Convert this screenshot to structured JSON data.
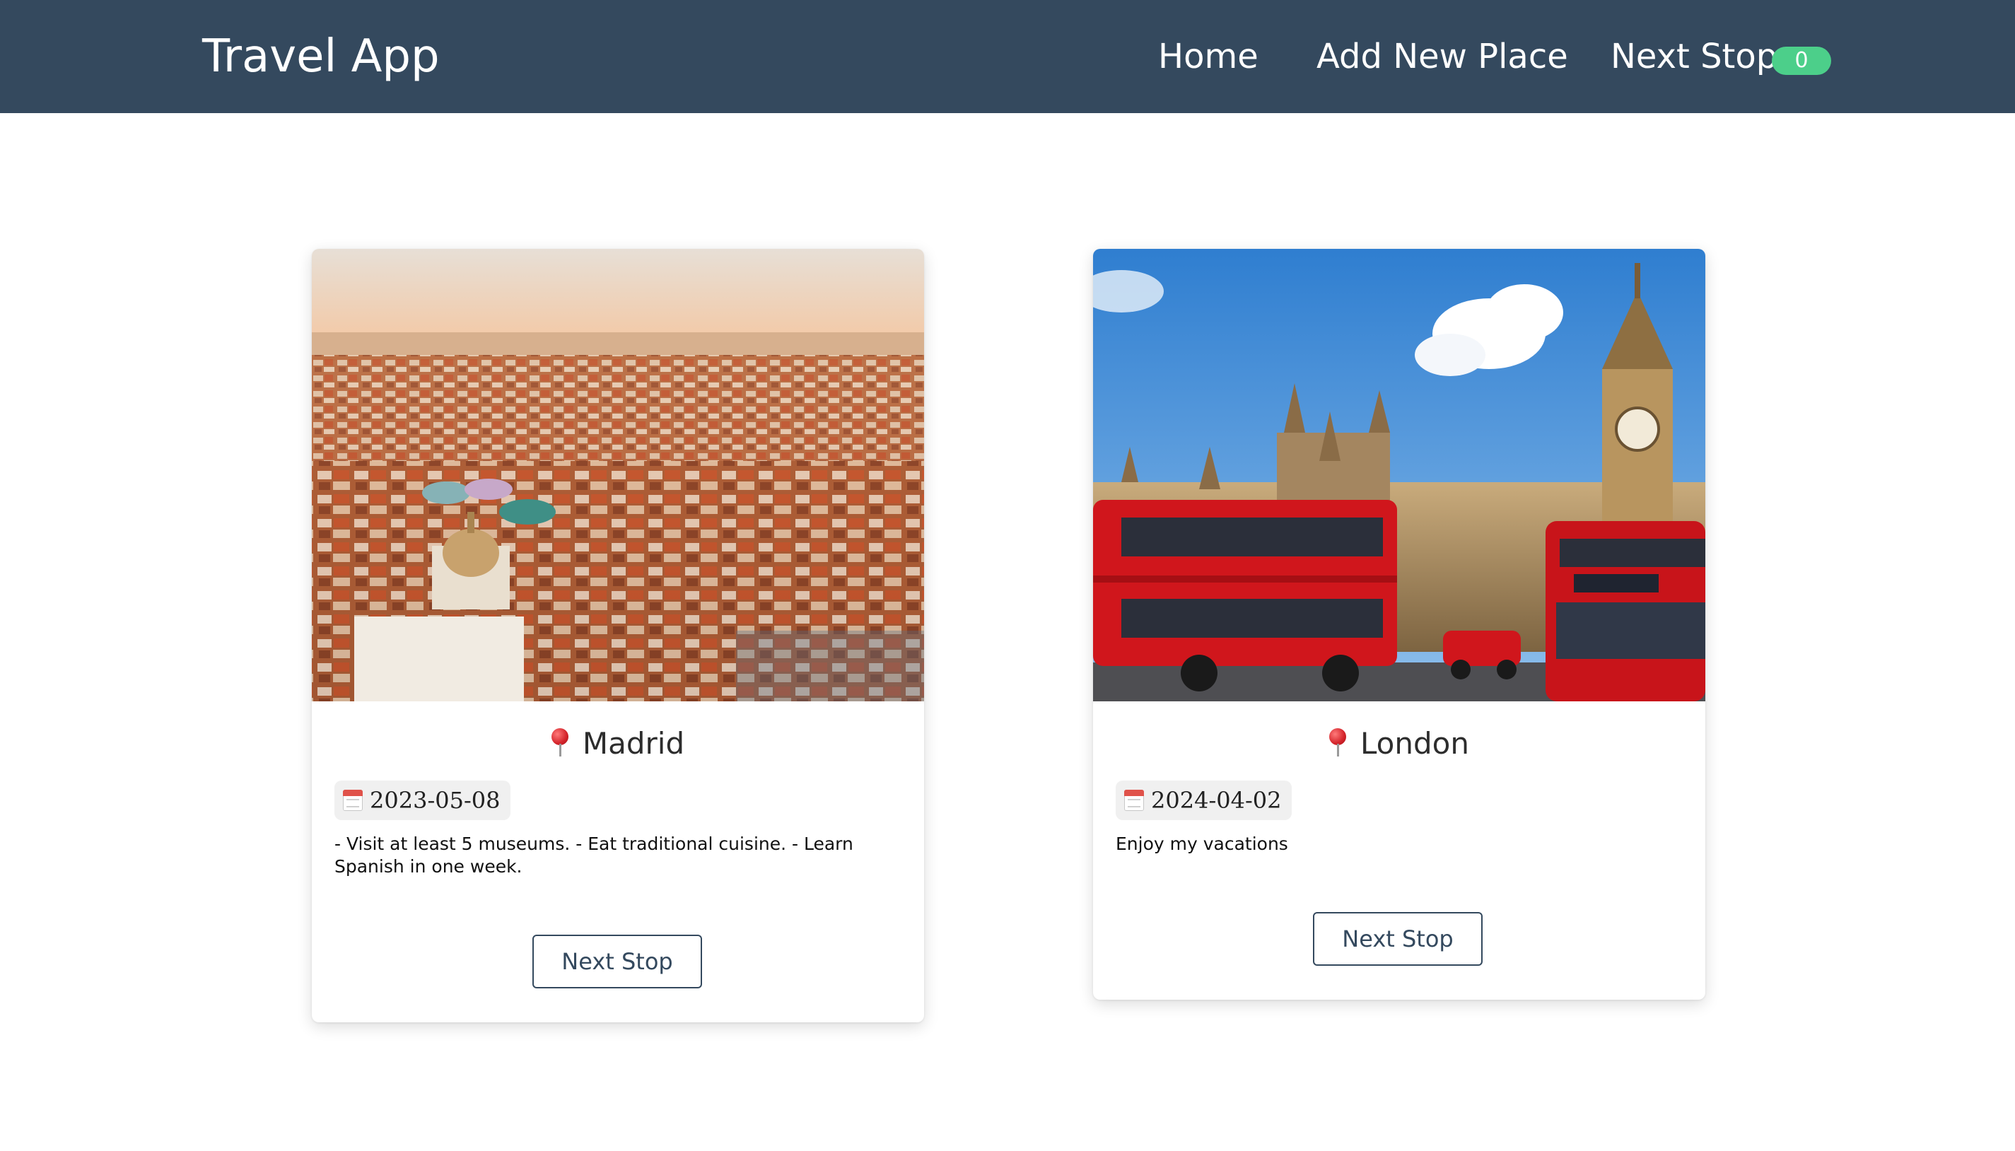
{
  "navbar": {
    "brand": "Travel App",
    "links": {
      "home": "Home",
      "add_new_place": "Add New Place",
      "next_stop": "Next Stop"
    },
    "next_stop_count": "0",
    "colors": {
      "background": "#34495e",
      "badge": "#4ccf8a"
    }
  },
  "places": [
    {
      "name": "Madrid",
      "date": "2023-05-08",
      "description": "- Visit at least 5 museums. - Eat traditional cuisine. - Learn Spanish in one week.",
      "button_label": "Next Stop",
      "image": "madrid-aerial-city-photo"
    },
    {
      "name": "London",
      "date": "2024-04-02",
      "description": "Enjoy my vacations",
      "button_label": "Next Stop",
      "image": "london-big-ben-red-buses-photo"
    }
  ],
  "icons": {
    "location": "map-pin-icon",
    "date": "calendar-icon"
  }
}
